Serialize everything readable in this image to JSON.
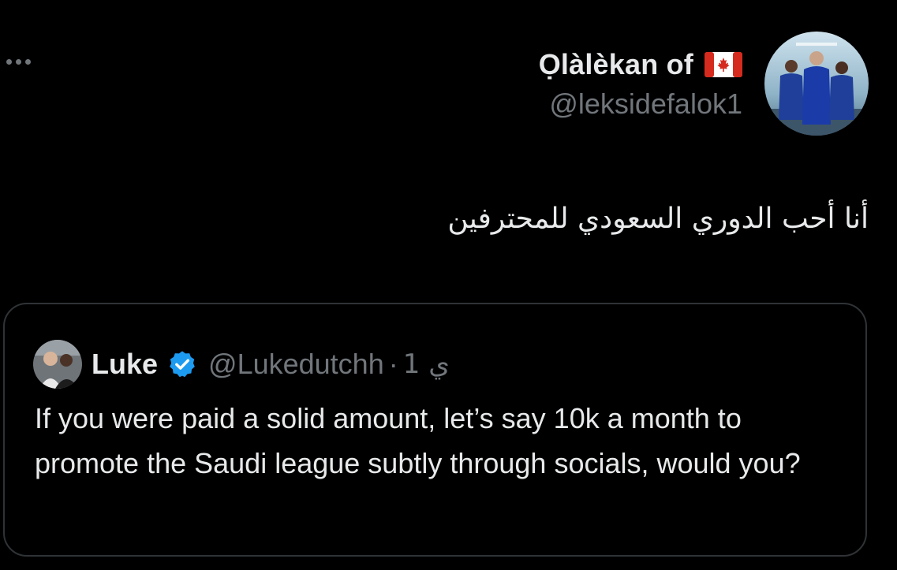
{
  "tweet": {
    "author": {
      "display_name": "Ọlàlèkan of",
      "flag_icon": "canada-flag-icon",
      "handle": "@leksidefalok1",
      "avatar_icon": "profile-photo-football-players"
    },
    "text": "أنا أحب الدوري السعودي للمحترفين",
    "more_icon": "more-horizontal-icon"
  },
  "quoted_tweet": {
    "author": {
      "display_name": "Luke",
      "verified_icon": "verified-badge-icon",
      "handle": "@Lukedutchh",
      "avatar_icon": "profile-photo-two-people"
    },
    "separator": "·",
    "time": "1 ي",
    "text": "If you were paid a solid amount, let’s say 10k a month to promote the Saudi league subtly through socials, would you?"
  },
  "colors": {
    "background": "#000000",
    "primary_text": "#e7e9ea",
    "secondary_text": "#71767b",
    "border": "#2f3336",
    "verified": "#1d9bf0",
    "flag_red": "#d52b1e"
  }
}
